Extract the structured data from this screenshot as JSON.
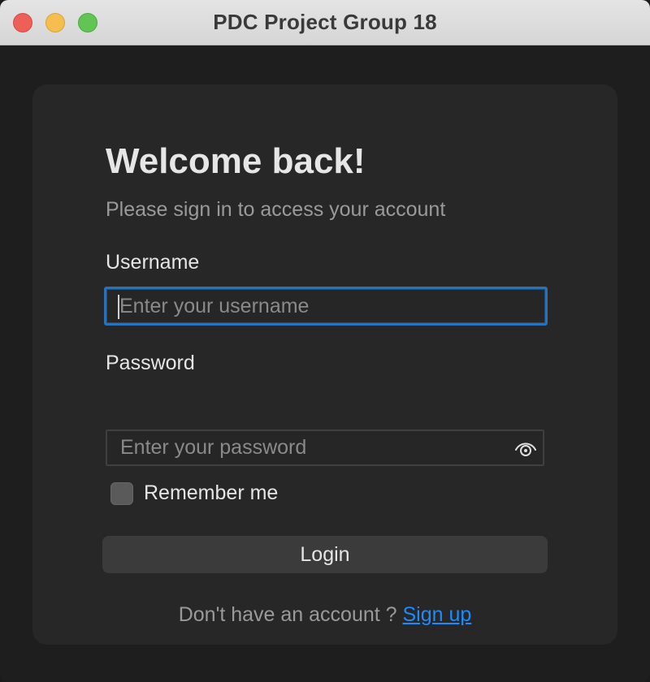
{
  "window": {
    "title": "PDC Project Group 18"
  },
  "form": {
    "heading": "Welcome back!",
    "subtitle": "Please sign in to access your account",
    "username_label": "Username",
    "username_value": "",
    "username_placeholder": "Enter your username",
    "password_label": "Password",
    "password_value": "",
    "password_placeholder": "Enter your password",
    "password_toggle_icon": "eye-icon",
    "remember_label": "Remember me",
    "remember_checked": false,
    "login_label": "Login",
    "signup_prompt": "Don't have an account ?",
    "signup_link": "Sign up"
  },
  "colors": {
    "focus_border": "#2a72b5",
    "link": "#1a8cff",
    "card_bg": "#272727",
    "button_bg": "#3b3b3b"
  }
}
